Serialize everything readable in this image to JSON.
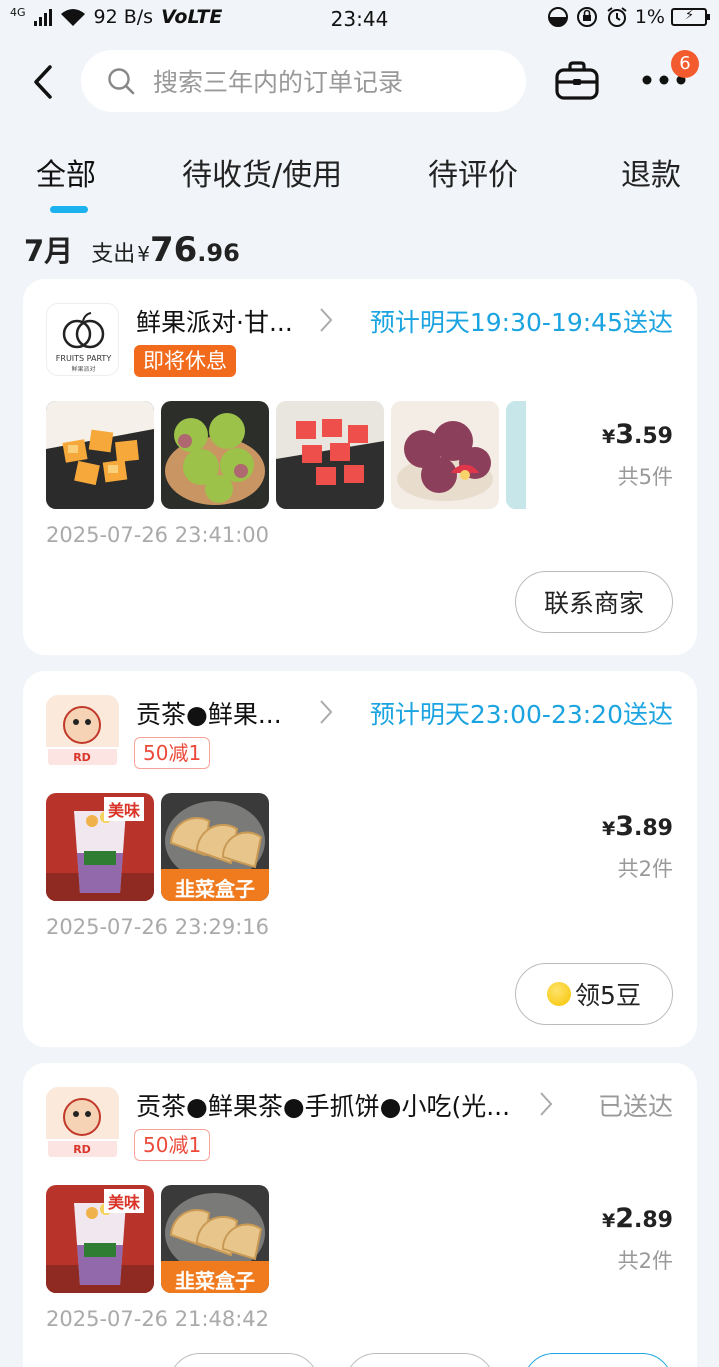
{
  "status_bar": {
    "network": "4G",
    "speed": "92 B/s",
    "volte": "VoLTE",
    "time": "23:44",
    "battery": "1%"
  },
  "header": {
    "search_placeholder": "搜索三年内的订单记录",
    "badge_count": "6"
  },
  "tabs": [
    {
      "label": "全部",
      "active": true
    },
    {
      "label": "待收货/使用",
      "active": false
    },
    {
      "label": "待评价",
      "active": false
    },
    {
      "label": "退款",
      "active": false
    }
  ],
  "summary": {
    "month": "7月",
    "label": "支出",
    "yen": "¥",
    "amount_int": "76",
    "amount_dec": ".96"
  },
  "orders": [
    {
      "shop": "鲜果派对·甘...",
      "logo_text": "FRUITS PARTY",
      "logo_sub": "鲜果派对",
      "tag": "即将休息",
      "status": "预计明天19:30-19:45送达",
      "yen": "¥",
      "price_int": "3",
      "price_dec": ".59",
      "count": "共5件",
      "time": "2025-07-26 23:41:00",
      "button": "联系商家",
      "thumbs": [
        "melon-cubes",
        "green-plums",
        "watermelon-cubes",
        "red-plums",
        "snack-box"
      ]
    },
    {
      "shop": "贡茶●鲜果...",
      "tag": "50减1",
      "status": "预计明天23:00-23:20送达",
      "yen": "¥",
      "price_int": "3",
      "price_dec": ".89",
      "count": "共2件",
      "time": "2025-07-26 23:29:16",
      "button": "领5豆",
      "thumbs": [
        "milk-tea-cup",
        "chive-box"
      ],
      "thumb_texts": [
        "美味",
        "韭菜盒子"
      ]
    },
    {
      "shop": "贡茶●鲜果茶●手抓饼●小吃(光...",
      "tag": "50减1",
      "status": "已送达",
      "yen": "¥",
      "price_int": "2",
      "price_dec": ".89",
      "count": "共2件",
      "time": "2025-07-26 21:48:42",
      "thumbs": [
        "milk-tea-cup",
        "chive-box"
      ],
      "thumb_texts": [
        "美味",
        "韭菜盒子"
      ]
    }
  ],
  "colors": {
    "accent_blue": "#1ba4e0",
    "tab_underline": "#1cb2f0",
    "tag_orange": "#f26a1b",
    "discount_red": "#ec4a3a",
    "background": "#f1f4f8"
  }
}
